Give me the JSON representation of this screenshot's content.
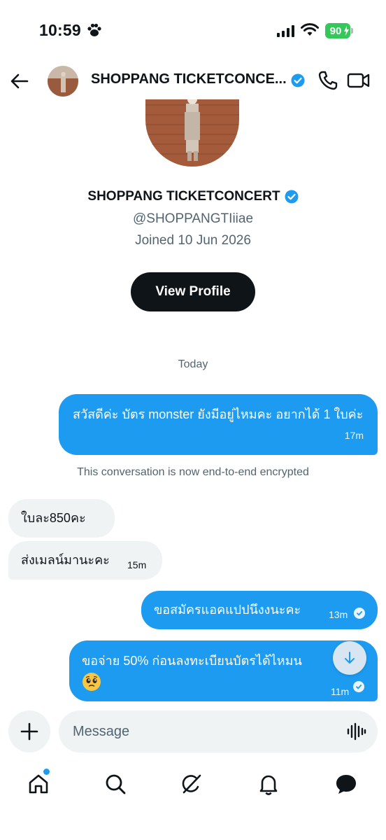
{
  "status_bar": {
    "time": "10:59",
    "battery": "90"
  },
  "header": {
    "title": "SHOPPANG TICKETCONCE..."
  },
  "profile": {
    "name": "SHOPPANG TICKETCONCERT",
    "handle": "@SHOPPANGTIiiae",
    "joined": "Joined 10 Jun 2026",
    "view_profile_label": "View Profile"
  },
  "day_separator": "Today",
  "encryption_notice": "This conversation is now end-to-end encrypted",
  "messages": [
    {
      "direction": "sent",
      "text": "สวัสดีค่ะ บัตร monster ยังมีอยู่ไหมคะ อยากได้ 1 ใบค่ะ",
      "time": "17m"
    },
    {
      "direction": "received",
      "text": "ใบละ850คะ",
      "time": ""
    },
    {
      "direction": "received",
      "text": "ส่งเมลน์มานะคะ",
      "time": "15m"
    },
    {
      "direction": "sent",
      "text": "ขอสมัครแอคแปปนึงงนะคะ",
      "time": "13m"
    },
    {
      "direction": "sent",
      "text": "ขอจ่าย 50% ก่อนลงทะเบียนบัตรได้ไหมน",
      "time": "11m"
    }
  ],
  "composer": {
    "placeholder": "Message"
  },
  "icons": {
    "back": "arrow-left-icon",
    "phone": "phone-icon",
    "video": "video-camera-icon",
    "verified": "verified-badge-icon",
    "plus": "plus-icon",
    "voice": "waveform-icon",
    "scroll": "arrow-down-icon"
  },
  "nav": [
    "home-icon",
    "search-icon",
    "grok-icon",
    "bell-icon",
    "messages-icon"
  ],
  "colors": {
    "accent": "#1d9bf0",
    "dark": "#0f1419",
    "muted": "#536471",
    "bubble_received": "#eff3f4",
    "battery": "#34c759"
  }
}
